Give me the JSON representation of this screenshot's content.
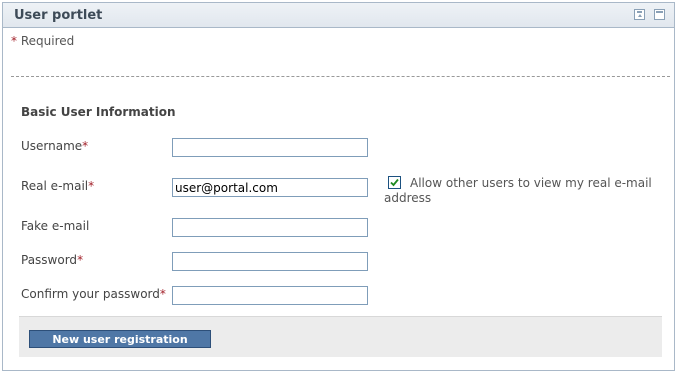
{
  "portlet": {
    "title": "User portlet",
    "required_marker": "*",
    "required_text": "Required"
  },
  "form": {
    "section_title": "Basic User Information",
    "fields": [
      {
        "label": "Username",
        "required_marker": "*",
        "value": ""
      },
      {
        "label": "Real e-mail",
        "required_marker": "*",
        "value": "user@portal.com"
      },
      {
        "label": "Fake e-mail",
        "required_marker": "",
        "value": ""
      },
      {
        "label": "Password",
        "required_marker": "*",
        "value": ""
      },
      {
        "label": "Confirm your password",
        "required_marker": "*",
        "value": ""
      }
    ],
    "email_visibility": {
      "label": "Allow other users to view my real e-mail address",
      "checked": true
    },
    "submit_label": "New user registration"
  },
  "icons": {
    "minimize": "minimize-icon",
    "maximize": "maximize-icon"
  },
  "colors": {
    "accent": "#4f77a6",
    "required": "#a3222b",
    "titlebar": "#e1e7ee"
  }
}
